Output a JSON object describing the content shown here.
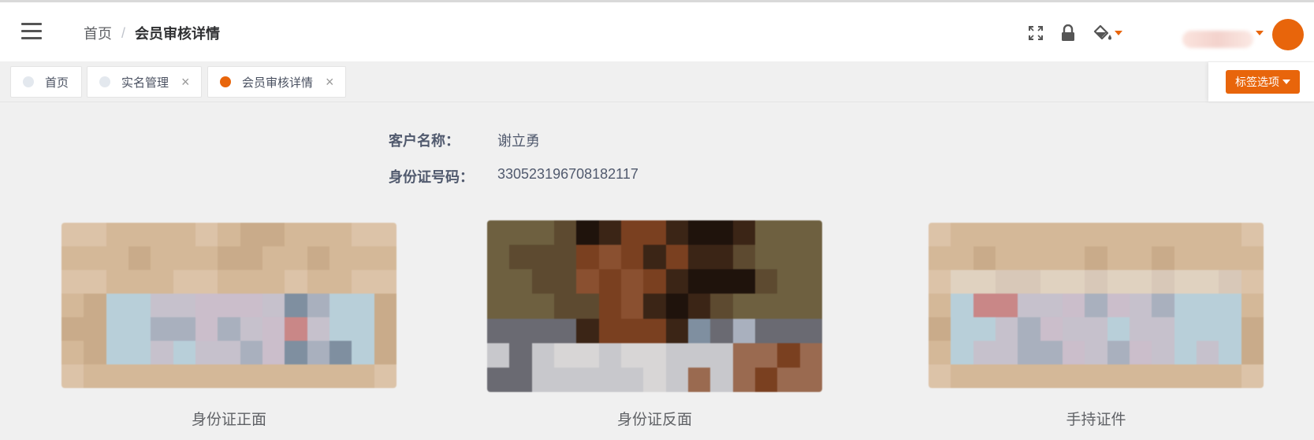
{
  "header": {
    "breadcrumb": {
      "home": "首页",
      "separator": "/",
      "current": "会员审核详情"
    },
    "icons": [
      "menu-icon",
      "fullscreen-icon",
      "lock-icon",
      "paint-bucket-icon",
      "avatar"
    ],
    "accent_color": "#e8650b"
  },
  "tabs": [
    {
      "label": "首页",
      "active": false,
      "closable": false
    },
    {
      "label": "实名管理",
      "active": false,
      "closable": true
    },
    {
      "label": "会员审核详情",
      "active": true,
      "closable": true
    }
  ],
  "tab_options_label": "标签选项",
  "close_glyph": "×",
  "detail": {
    "customer_name_label": "客户名称：",
    "customer_name": "谢立勇",
    "id_number_label": "身份证号码：",
    "id_number": "330523196708182117"
  },
  "images": [
    {
      "caption": "身份证正面"
    },
    {
      "caption": "身份证反面"
    },
    {
      "caption": "手持证件"
    }
  ]
}
